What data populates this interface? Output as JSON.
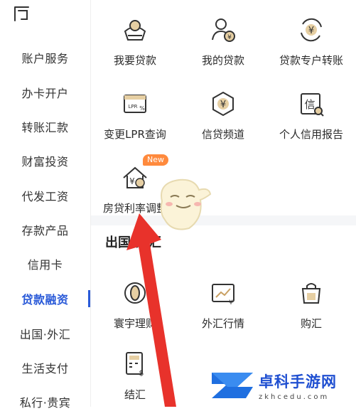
{
  "sidebar": {
    "items": [
      {
        "label": "账户服务"
      },
      {
        "label": "办卡开户"
      },
      {
        "label": "转账汇款"
      },
      {
        "label": "财富投资"
      },
      {
        "label": "代发工资"
      },
      {
        "label": "存款产品"
      },
      {
        "label": "信用卡"
      },
      {
        "label": "贷款融资",
        "active": true
      },
      {
        "label": "出国·外汇"
      },
      {
        "label": "生活支付"
      },
      {
        "label": "私行·贵宾"
      }
    ]
  },
  "loan_section": {
    "tiles": [
      {
        "label": "我要贷款",
        "icon": "loan-coin-icon"
      },
      {
        "label": "我的贷款",
        "icon": "user-coin-icon"
      },
      {
        "label": "贷款专户转账",
        "icon": "yuan-transfer-icon"
      },
      {
        "label": "变更LPR查询",
        "icon": "lpr-card-icon",
        "icon_text": "LPR"
      },
      {
        "label": "信贷频道",
        "icon": "yuan-hexagon-icon"
      },
      {
        "label": "个人信用报告",
        "icon": "credit-report-icon",
        "icon_text": "信"
      },
      {
        "label": "房贷利率调整",
        "icon": "house-yuan-icon",
        "badge": "New"
      }
    ]
  },
  "forex_section": {
    "title": "出国·外汇",
    "tiles": [
      {
        "label": "寰宇理财",
        "icon": "globe-coin-icon"
      },
      {
        "label": "外汇行情",
        "icon": "chart-card-icon"
      },
      {
        "label": "购汇",
        "icon": "shopping-bag-icon"
      },
      {
        "label": "结汇",
        "icon": "calculator-icon"
      }
    ]
  },
  "watermark": {
    "name": "卓科手游网",
    "domain": "zkhcedu.com"
  },
  "colors": {
    "accent": "#2a5ad8",
    "badge": "#ff8a3d",
    "arrow": "#e8322b",
    "icon_gold": "#c9a063"
  }
}
